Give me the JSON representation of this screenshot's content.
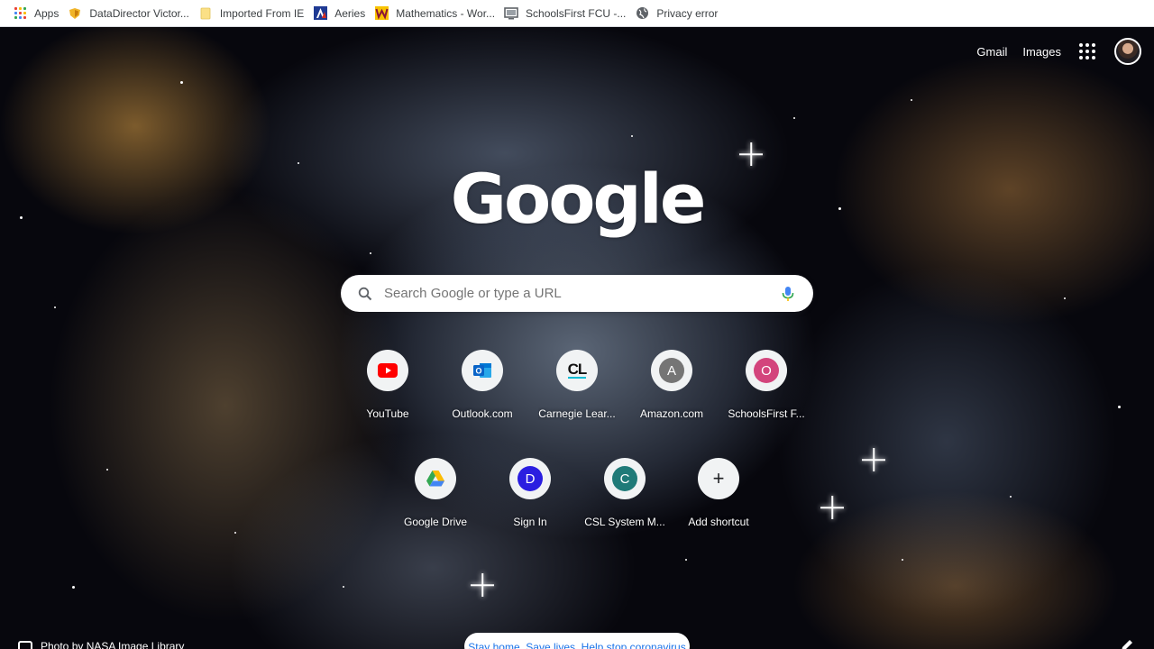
{
  "bookmarks": [
    {
      "label": "Apps",
      "icon": "apps-grid-icon"
    },
    {
      "label": "DataDirector Victor...",
      "icon": "shield-icon",
      "color": "#f0b429"
    },
    {
      "label": "Imported From IE",
      "icon": "folder-icon",
      "color": "#fbe086"
    },
    {
      "label": "Aeries",
      "icon": "aeries-logo-icon",
      "color": "#1f3a93"
    },
    {
      "label": "Mathematics - Wor...",
      "icon": "w-logo-icon",
      "color": "#f9c300"
    },
    {
      "label": "SchoolsFirst FCU -...",
      "icon": "monitor-icon",
      "color": "#5f6368"
    },
    {
      "label": "Privacy error",
      "icon": "globe-icon",
      "color": "#5f6368"
    }
  ],
  "header": {
    "gmail_label": "Gmail",
    "images_label": "Images",
    "apps_icon": "google-apps-icon",
    "avatar": "account-avatar"
  },
  "logo": {
    "text": "Google"
  },
  "search": {
    "placeholder": "Search Google or type a URL",
    "value": "",
    "search_icon": "search-icon",
    "mic_icon": "microphone-icon"
  },
  "shortcuts": {
    "row1": [
      {
        "title": "YouTube",
        "icon": "youtube-icon",
        "color": "#ff0000"
      },
      {
        "title": "Outlook.com",
        "icon": "outlook-icon",
        "color": "#0a64c8"
      },
      {
        "title": "Carnegie Lear...",
        "icon": "carnegie-learning-icon",
        "glyph": "CL",
        "color": "#111111"
      },
      {
        "title": "Amazon.com",
        "icon": "letter-a-icon",
        "glyph": "A",
        "color": "#757575"
      },
      {
        "title": "SchoolsFirst F...",
        "icon": "letter-o-icon",
        "glyph": "O",
        "color": "#d3447c"
      }
    ],
    "row2": [
      {
        "title": "Google Drive",
        "icon": "google-drive-icon"
      },
      {
        "title": "Sign In",
        "icon": "letter-d-icon",
        "glyph": "D",
        "color": "#2a1ee0"
      },
      {
        "title": "CSL System M...",
        "icon": "letter-c-icon",
        "glyph": "C",
        "color": "#1f7a78"
      },
      {
        "title": "Add shortcut",
        "icon": "plus-icon",
        "glyph": "+"
      }
    ]
  },
  "footer": {
    "attribution": "Photo by NASA Image Library",
    "promo": "Stay home. Save lives. Help stop coronavirus",
    "customize_icon": "pencil-icon"
  }
}
